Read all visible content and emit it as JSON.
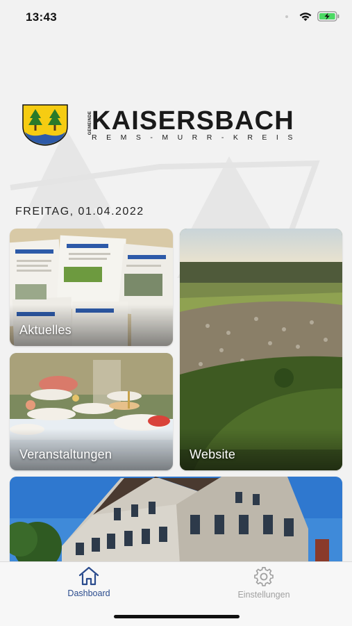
{
  "status_bar": {
    "time": "13:43",
    "icons": [
      "wifi-icon",
      "battery-charging-icon"
    ]
  },
  "logo": {
    "prefix": "GEMEINDE",
    "title": "KAISERSBACH",
    "subtitle": "REMS-MURR-KREIS"
  },
  "date": "FREITAG, 01.04.2022",
  "tiles": [
    {
      "label": "Aktuelles"
    },
    {
      "label": "Veranstaltungen"
    },
    {
      "label": "Website"
    },
    {
      "label": ""
    }
  ],
  "tab_bar": {
    "items": [
      {
        "label": "Dashboard",
        "icon": "home-icon",
        "active": true
      },
      {
        "label": "Einstellungen",
        "icon": "gear-icon",
        "active": false
      }
    ]
  },
  "colors": {
    "accent": "#2a4b8d",
    "inactive": "#a0a0a0",
    "background": "#f2f2f2"
  }
}
